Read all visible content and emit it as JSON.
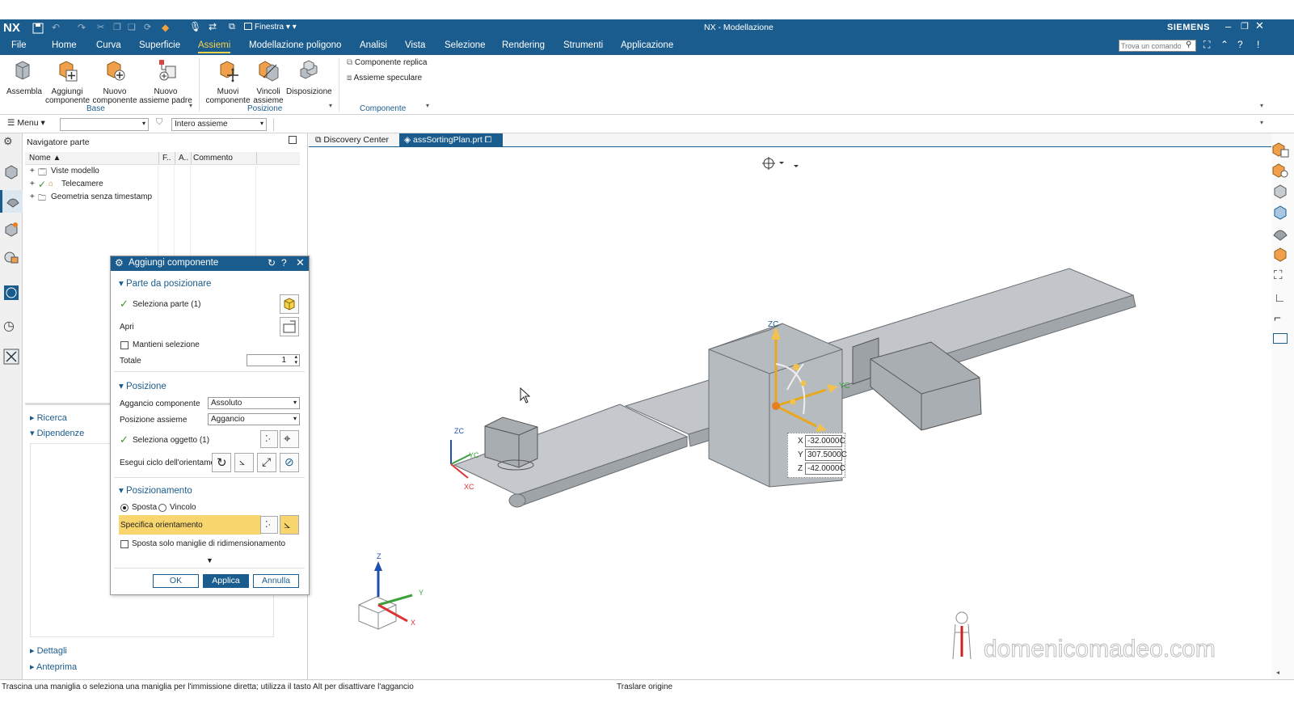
{
  "app": {
    "logo": "NX",
    "window_title": "NX - Modellazione",
    "brand": "SIEMENS",
    "window_menu": "Finestra",
    "search_placeholder": "Trova un comando"
  },
  "ribbon_tabs": [
    "File",
    "Home",
    "Curva",
    "Superficie",
    "Assiemi",
    "Modellazione poligono",
    "Analisi",
    "Vista",
    "Selezione",
    "Rendering",
    "Strumenti",
    "Applicazione"
  ],
  "ribbon_buttons": {
    "assembla": "Assembla",
    "aggiungi_1": "Aggiungi",
    "aggiungi_2": "componente",
    "nuovo_comp_1": "Nuovo",
    "nuovo_comp_2": "componente",
    "nuovo_padre_1": "Nuovo",
    "nuovo_padre_2": "assieme padre",
    "muovi_1": "Muovi",
    "muovi_2": "componente",
    "vincoli_1": "Vincoli",
    "vincoli_2": "assieme",
    "disposizione": "Disposizione",
    "componente_replica": "Componente replica",
    "assieme_speculare": "Assieme speculare"
  },
  "ribbon_groups": {
    "base": "Base",
    "posizione": "Posizione",
    "componente": "Componente"
  },
  "toolbar2": {
    "menu": "Menu",
    "filter_value": "",
    "scope": "Intero assieme"
  },
  "doc_tabs": [
    "Discovery Center",
    "assSortingPlan.prt"
  ],
  "navigator": {
    "title": "Navigatore parte",
    "columns": [
      "Nome",
      "F..",
      "A..",
      "Commento"
    ],
    "rows": [
      "Viste modello",
      "Telecamere",
      "Geometria senza timestamp"
    ],
    "panels": [
      "Ricerca",
      "Dipendenze",
      "Dettagli",
      "Anteprima"
    ]
  },
  "dialog": {
    "title": "Aggiungi componente",
    "section_parte": "Parte da posizionare",
    "seleziona_parte": "Seleziona parte (1)",
    "apri": "Apri",
    "mantieni": "Mantieni selezione",
    "totale_label": "Totale",
    "totale_value": "1",
    "section_posizione": "Posizione",
    "aggancio_label": "Aggancio componente",
    "aggancio_value": "Assoluto",
    "posizione_label": "Posizione assieme",
    "posizione_value": "Aggancio",
    "seleziona_oggetto": "Seleziona oggetto (1)",
    "ciclo": "Esegui ciclo dell'orientame",
    "section_posizionamento": "Posizionamento",
    "sposta": "Sposta",
    "vincolo": "Vincolo",
    "specifica": "Specifica orientamento",
    "sposta_solo": "Sposta solo maniglie di ridimensionamento",
    "ok": "OK",
    "applica": "Applica",
    "annulla": "Annulla"
  },
  "coords": {
    "x_label": "X",
    "x": "-32.0000C",
    "y_label": "Y",
    "y": "307.5000C",
    "z_label": "Z",
    "z": "-42.0000C"
  },
  "axis_labels": {
    "zc": "ZC",
    "yc": "YC",
    "xc": "XC",
    "z": "Z",
    "y": "Y",
    "x": "X"
  },
  "watermark": "domenicomadeo.com",
  "status": {
    "message": "Trascina una maniglia o seleziona una maniglia per l'immissione diretta; utilizza il tasto Alt per disattivare l'aggancio",
    "mode": "Traslare origine"
  },
  "colors": {
    "accent": "#1a5c8d",
    "highlight": "#f9d56e",
    "model": "#b4b8bd"
  }
}
